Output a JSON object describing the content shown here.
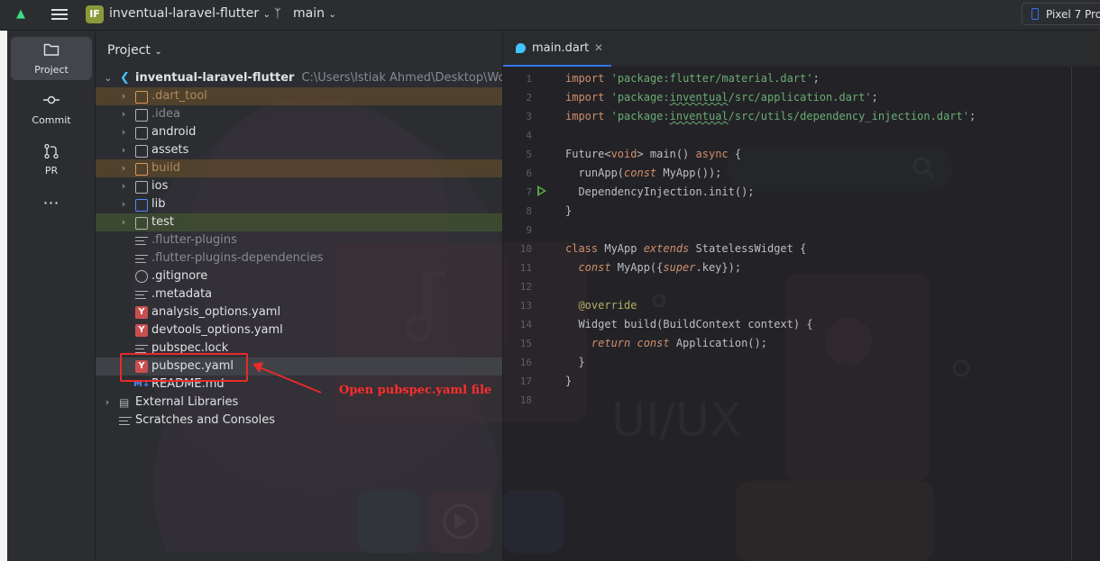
{
  "topbar": {
    "project_badge": "IF",
    "project_name": "inventual-laravel-flutter",
    "branch": "main",
    "device": "Pixel 7 Pro"
  },
  "toolbar": {
    "items": [
      {
        "label": "Project",
        "icon": "folder-icon",
        "active": true
      },
      {
        "label": "Commit",
        "icon": "commit-icon"
      },
      {
        "label": "PR",
        "icon": "pull-request-icon"
      },
      {
        "label": "",
        "icon": "more-icon"
      }
    ]
  },
  "project": {
    "header": "Project",
    "root": {
      "name": "inventual-laravel-flutter",
      "path": "C:\\Users\\Istiak Ahmed\\Desktop\\Work Pla"
    },
    "items": [
      {
        "name": ".dart_tool",
        "type": "folder"
      },
      {
        "name": ".idea",
        "type": "folder"
      },
      {
        "name": "android",
        "type": "folder"
      },
      {
        "name": "assets",
        "type": "folder"
      },
      {
        "name": "build",
        "type": "folder"
      },
      {
        "name": "ios",
        "type": "folder"
      },
      {
        "name": "lib",
        "type": "folder"
      },
      {
        "name": "test",
        "type": "folder"
      },
      {
        "name": ".flutter-plugins",
        "type": "file"
      },
      {
        "name": ".flutter-plugins-dependencies",
        "type": "file"
      },
      {
        "name": ".gitignore",
        "type": "file"
      },
      {
        "name": ".metadata",
        "type": "file"
      },
      {
        "name": "analysis_options.yaml",
        "type": "yaml"
      },
      {
        "name": "devtools_options.yaml",
        "type": "yaml"
      },
      {
        "name": "pubspec.lock",
        "type": "file"
      },
      {
        "name": "pubspec.yaml",
        "type": "yaml"
      },
      {
        "name": "README.md",
        "type": "md"
      }
    ],
    "external_libraries": "External Libraries",
    "scratches": "Scratches and Consoles"
  },
  "callout": {
    "text": "Open pubspec.yaml file",
    "color": "#ff2d2d"
  },
  "editor": {
    "tab": "main.dart",
    "line_numbers": [
      "1",
      "2",
      "3",
      "4",
      "5",
      "6",
      "7",
      "8",
      "9",
      "10",
      "11",
      "12",
      "13",
      "14",
      "15",
      "16",
      "17",
      "18"
    ],
    "code": {
      "l1_kw": "import",
      "l1_str": "'package:flutter/material.dart'",
      "l1_end": ";",
      "l2_kw": "import",
      "l2_str_a": "'package:",
      "l2_str_b": "inventual",
      "l2_str_c": "/src/application.dart'",
      "l2_end": ";",
      "l3_kw": "import",
      "l3_str_a": "'package:",
      "l3_str_b": "inventual",
      "l3_str_c": "/src/utils/dependency_injection.dart'",
      "l3_end": ";",
      "l5_a": "Future<",
      "l5_void": "void",
      "l5_b": "> main() ",
      "l5_async": "async",
      "l5_c": " {",
      "l6_a": "  runApp(",
      "l6_const": "const",
      "l6_b": " MyApp());",
      "l7": "  DependencyInjection.init();",
      "l8": "}",
      "l10_class": "class",
      "l10_a": " MyApp ",
      "l10_extends": "extends",
      "l10_b": " StatelessWidget {",
      "l11_const": "  const",
      "l11_a": " MyApp({",
      "l11_super": "super",
      "l11_b": ".key});",
      "l13": "  @override",
      "l14_a": "  Widget ",
      "l14_build": "build",
      "l14_b": "(BuildContext context) {",
      "l15_return": "    return",
      "l15_const": " const",
      "l15_b": " Application();",
      "l16": "  }",
      "l17": "}"
    }
  }
}
